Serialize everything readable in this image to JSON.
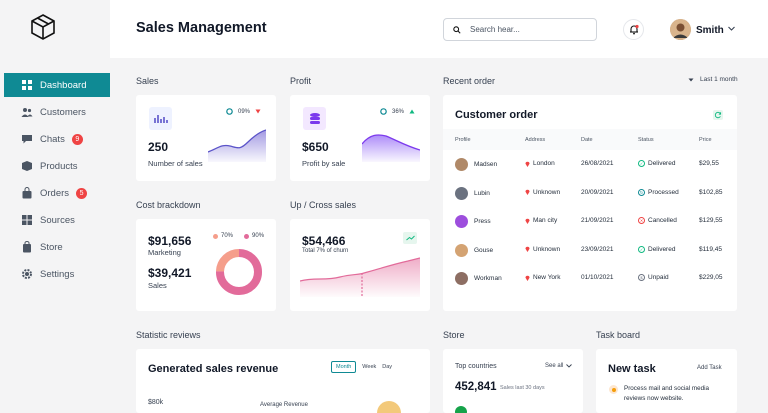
{
  "sidebar": {
    "items": [
      {
        "label": "Dashboard",
        "icon": "grid-icon",
        "active": true
      },
      {
        "label": "Customers",
        "icon": "users-icon"
      },
      {
        "label": "Chats",
        "icon": "chat-icon",
        "badge": "9"
      },
      {
        "label": "Products",
        "icon": "box-icon"
      },
      {
        "label": "Orders",
        "icon": "bag-icon",
        "badge": "5"
      },
      {
        "label": "Sources",
        "icon": "sources-icon"
      },
      {
        "label": "Store",
        "icon": "store-icon"
      },
      {
        "label": "Settings",
        "icon": "gear-icon"
      }
    ]
  },
  "header": {
    "title": "Sales Management",
    "search_placeholder": "Search hear...",
    "username": "Smith"
  },
  "sales": {
    "section": "Sales",
    "value": "250",
    "label": "Number of sales",
    "pct": "09%"
  },
  "profit": {
    "section": "Profit",
    "value": "$650",
    "label": "Profit by sale",
    "pct": "36%"
  },
  "cost": {
    "section": "Cost brackdown",
    "value1": "$91,656",
    "label1": "Marketing",
    "value2": "$39,421",
    "label2": "Sales",
    "legend1": "70%",
    "legend2": "90%"
  },
  "upsales": {
    "section": "Up / Cross sales",
    "value": "$54,466",
    "label": "Total 7% of churn"
  },
  "recent": {
    "section": "Recent order",
    "filter": "Last 1 month",
    "card_title": "Customer order",
    "columns": [
      "Profile",
      "Address",
      "Date",
      "Status",
      "Price"
    ],
    "rows": [
      {
        "name": "Madsen",
        "address": "London",
        "date": "26/08/2021",
        "status": "Delivered",
        "price": "$29,55"
      },
      {
        "name": "Lubin",
        "address": "Unknown",
        "date": "20/09/2021",
        "status": "Processed",
        "price": "$102,85"
      },
      {
        "name": "Press",
        "address": "Man city",
        "date": "21/09/2021",
        "status": "Cancelled",
        "price": "$129,55"
      },
      {
        "name": "Gouse",
        "address": "Unknown",
        "date": "23/09/2021",
        "status": "Delivered",
        "price": "$119,45"
      },
      {
        "name": "Workman",
        "address": "New York",
        "date": "01/10/2021",
        "status": "Unpaid",
        "price": "$229,05"
      }
    ]
  },
  "statistic": {
    "section": "Statistic reviews",
    "card_title": "Generated sales revenue",
    "tabs": [
      "Month",
      "Week",
      "Day"
    ],
    "ytick": "$80k",
    "legend": "Average Revenue"
  },
  "store": {
    "section": "Store",
    "subtitle": "Top countries",
    "see_all": "See all",
    "value": "452,841",
    "label": "Sales last 30 days"
  },
  "taskboard": {
    "section": "Task board",
    "card_title": "New task",
    "add": "Add Task",
    "task_text": "Process mail and social media reviews now website."
  },
  "colors": {
    "accent": "#0f8a94",
    "purple": "#7c6fd6",
    "pink": "#e26b9a",
    "badge": "#ef4444"
  }
}
